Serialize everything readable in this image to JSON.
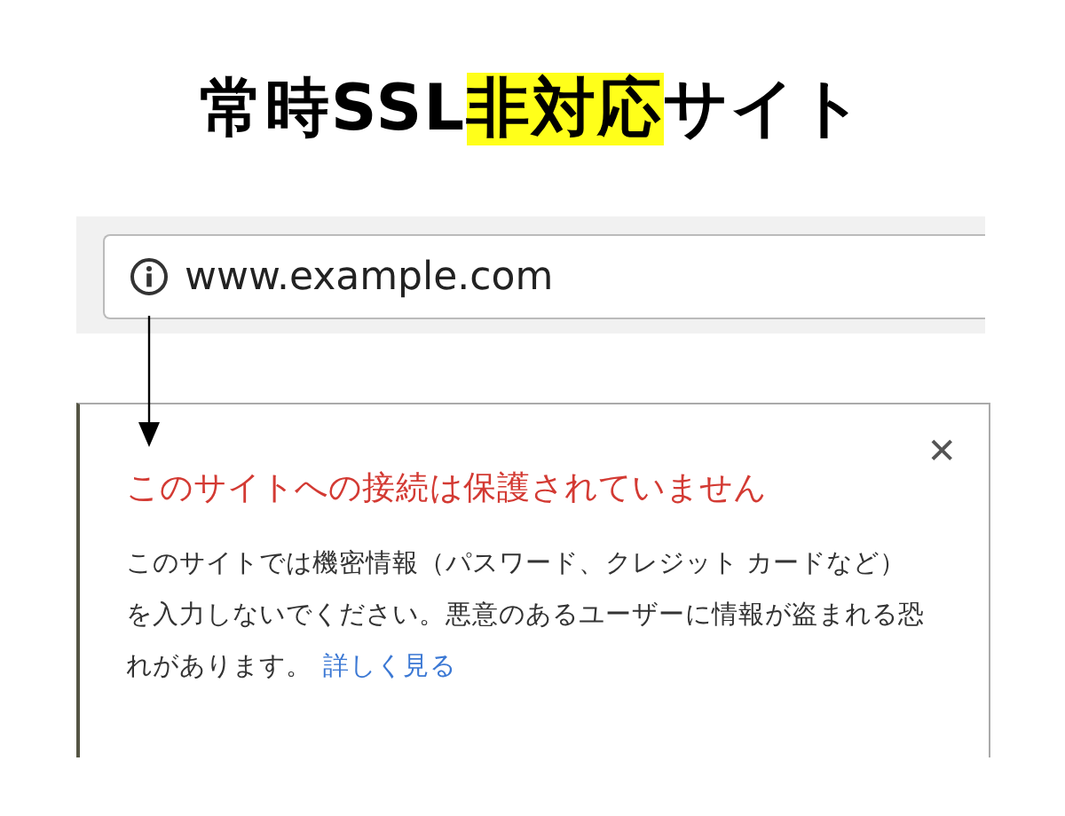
{
  "heading": {
    "before": "常時SSL",
    "highlight": "非対応",
    "after": "サイト"
  },
  "address_bar": {
    "url": "www.example.com"
  },
  "popup": {
    "title": "このサイトへの接続は保護されていません",
    "close": "✕",
    "message": "このサイトでは機密情報（パスワード、クレジット カードなど）を入力しないでください。悪意のあるユーザーに情報が盗まれる恐れがあります。",
    "link": "詳しく見る"
  }
}
